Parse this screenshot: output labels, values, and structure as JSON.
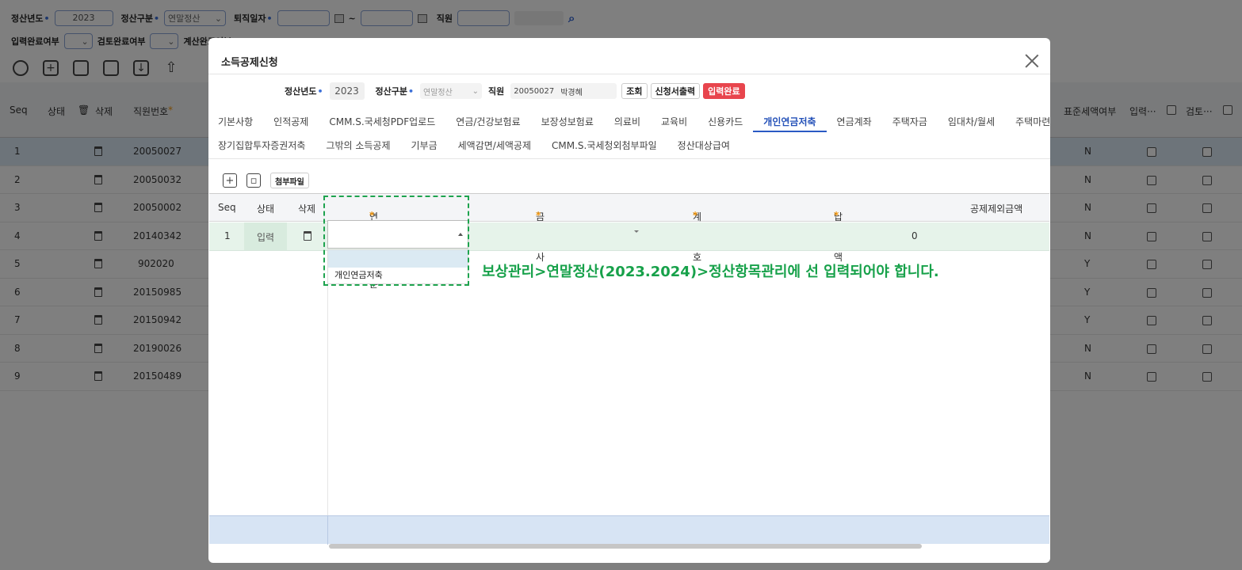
{
  "filters": {
    "year_label": "정산년도",
    "year_value": "2023",
    "type_label": "정산구분",
    "type_value": "연말정산",
    "retire_label": "퇴직일자",
    "date_sep": "~",
    "emp_label": "직원",
    "input_done_label": "입력완료여부",
    "review_done_label": "검토완료여부",
    "calc_done_label": "계산완료여부"
  },
  "bg_grid": {
    "headers": [
      "Seq",
      "상태",
      "삭제",
      "직원번호",
      "표준세액여부",
      "입력···",
      "검토···"
    ],
    "rows": [
      {
        "seq": "1",
        "emp": "20050027",
        "std": "N"
      },
      {
        "seq": "2",
        "emp": "20050032",
        "std": "N"
      },
      {
        "seq": "3",
        "emp": "20050002",
        "std": "N"
      },
      {
        "seq": "4",
        "emp": "20140342",
        "std": "N"
      },
      {
        "seq": "5",
        "emp": "902020",
        "std": "Y"
      },
      {
        "seq": "6",
        "emp": "20150985",
        "std": "Y"
      },
      {
        "seq": "7",
        "emp": "20150942",
        "std": "Y"
      },
      {
        "seq": "8",
        "emp": "20190026",
        "std": "N"
      },
      {
        "seq": "9",
        "emp": "20150489",
        "std": "N"
      }
    ]
  },
  "modal": {
    "title": "소득공제신청",
    "search": {
      "year_label": "정산년도",
      "year_value": "2023",
      "type_label": "정산구분",
      "type_value": "연말정산",
      "emp_label": "직원",
      "emp_no": "20050027",
      "emp_name": "박경혜",
      "btn_search": "조회",
      "btn_print": "신청서출력",
      "btn_done": "입력완료"
    },
    "tabs_row1": [
      "기본사항",
      "인적공제",
      "CMM.S.국세청PDF업로드",
      "연금/건강보험료",
      "보장성보험료",
      "의료비",
      "교육비",
      "신용카드",
      "개인연금저축",
      "연금계좌",
      "주택자금",
      "임대차/월세",
      "주택마련저축"
    ],
    "tabs_row2": [
      "장기집합투자증권저축",
      "그밖의 소득공제",
      "기부금",
      "세액감면/세액공제",
      "CMM.S.국세청외첨부파일",
      "정산대상급여"
    ],
    "active_tab": "개인연금저축",
    "attach_label": "첨부파일",
    "grid": {
      "headers": {
        "seq": "Seq",
        "status": "상태",
        "delete": "삭제",
        "pension_type": "연금저축구분",
        "fin_company": "금융회사",
        "account_no": "계좌번호",
        "paid_amount": "납입금액",
        "excluded_amount": "공제제외금액"
      },
      "row": {
        "seq": "1",
        "status": "입력",
        "paid_amount": "0"
      },
      "dropdown_options": [
        "",
        "개인연금저축"
      ]
    },
    "note": "보상관리>연말정산(2023.2024)>정산항목관리에 선 입력되어야 합니다."
  }
}
